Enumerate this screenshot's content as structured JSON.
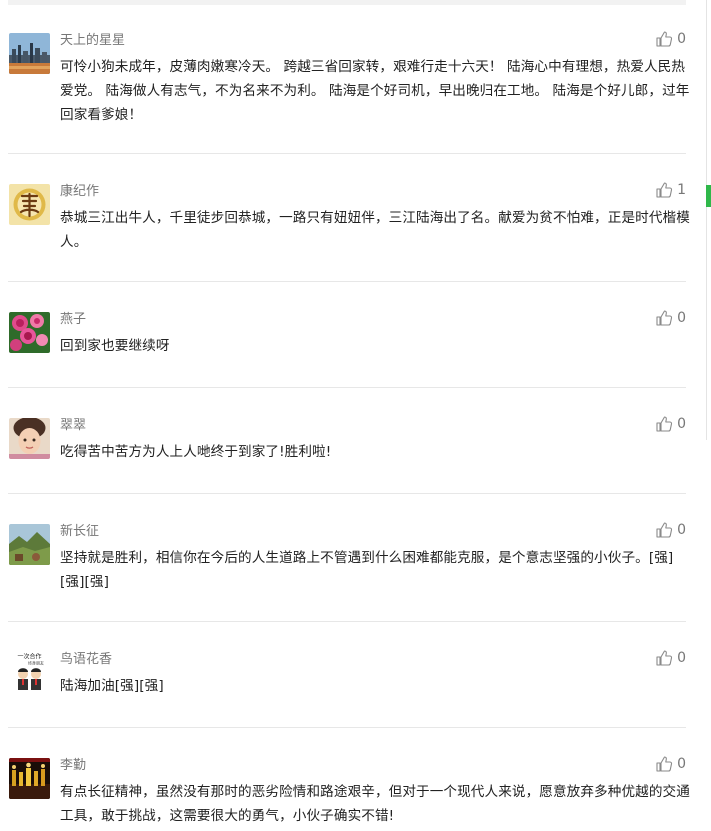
{
  "comments": [
    {
      "name": "天上的星星",
      "text": "可怜小狗未成年，皮薄肉嫩寒冷天。 跨越三省回家转，艰难行走十六天！ 陆海心中有理想，热爱人民热爱党。 陆海做人有志气，不为名来不为利。 陆海是个好司机，早出晚归在工地。 陆海是个好儿郎，过年回家看爹娘！",
      "likes": "0",
      "avatar_icon": "city-skyline-avatar"
    },
    {
      "name": "康纪作",
      "text": "恭城三江出牛人，千里徒步回恭城，一路只有妞妞伴，三江陆海出了名。献爱为贫不怕难，正是时代楷模人。",
      "likes": "1",
      "avatar_icon": "calligraphy-seal-avatar"
    },
    {
      "name": "燕子",
      "text": "回到家也要继续呀",
      "likes": "0",
      "avatar_icon": "roses-avatar"
    },
    {
      "name": "翠翠",
      "text": "吃得苦中苦方为人上人哋终于到家了!胜利啦!",
      "likes": "0",
      "avatar_icon": "child-portrait-avatar"
    },
    {
      "name": "新长征",
      "text": "坚持就是胜利，相信你在今后的人生道路上不管遇到什么困难都能克服，是个意志坚强的小伙子。[强][强][强]",
      "likes": "0",
      "avatar_icon": "landscape-avatar"
    },
    {
      "name": "鸟语花香",
      "text": "陆海加油[强][强]",
      "likes": "0",
      "avatar_icon": "cartoon-friends-avatar",
      "avatar_caption_1": "一次合作",
      "avatar_caption_2": "终身朋友"
    },
    {
      "name": "李勤",
      "text": "有点长征精神，虽然没有那时的恶劣险情和路途艰辛，但对于一个现代人来说，愿意放弃多种优越的交通工具，敢于挑战，这需要很大的勇气，小伙子确实不错!",
      "likes": "0",
      "avatar_icon": "stage-performance-avatar"
    }
  ],
  "colors": {
    "name": "#777777",
    "text": "#222222",
    "divider": "#e7e7e7",
    "scroll_marker": "#2fb84a"
  },
  "icons": {
    "like": "thumbs-up-icon"
  }
}
